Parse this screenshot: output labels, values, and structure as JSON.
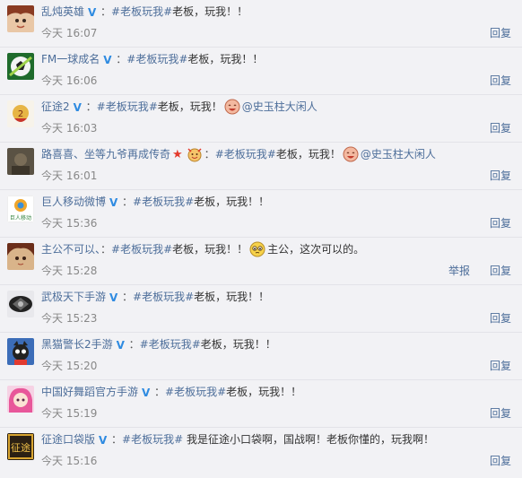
{
  "comments": [
    {
      "user": "乱炖英雄",
      "verified": true,
      "sep": "：",
      "tag": "#老板玩我#",
      "text": "老板，玩我！！",
      "time": "今天 16:07",
      "reply": "回复",
      "avatar_icon": "anime-character-avatar-icon"
    },
    {
      "user": "FM一球成名",
      "verified": true,
      "sep": "：",
      "tag": "#老板玩我#",
      "text": "老板，玩我！！",
      "time": "今天 16:06",
      "reply": "回复",
      "avatar_icon": "soccer-ball-avatar-icon"
    },
    {
      "user": "征途2",
      "verified": true,
      "sep": "：",
      "tag": "#老板玩我#",
      "text": "老板，玩我！",
      "emoji": "laughing-face-emoji",
      "mention": "@史玉柱大闲人",
      "time": "今天 16:03",
      "reply": "回复",
      "avatar_icon": "game-logo-avatar-icon"
    },
    {
      "user": "路喜喜、坐等九爷再成传奇",
      "star": "★",
      "emoji_pre": "cheering-face-emoji",
      "sep": "：",
      "tag": "#老板玩我#",
      "text": "老板，玩我！",
      "emoji": "laughing-face-emoji",
      "mention": "@史玉柱大闲人",
      "time": "今天 16:01",
      "reply": "回复",
      "avatar_icon": "dark-photo-avatar-icon"
    },
    {
      "user": "巨人移动微博",
      "verified": true,
      "sep": "：",
      "tag": "#老板玩我#",
      "text": "老板，玩我！！",
      "time": "今天 15:36",
      "reply": "回复",
      "avatar_icon": "giant-logo-avatar-icon",
      "avatar_text": "巨人移动"
    },
    {
      "user": "主公不可以、",
      "sep": "：",
      "tag": "#老板玩我#",
      "text": "老板，玩我！！",
      "emoji": "pleading-face-emoji",
      "text2": "主公，这次可以的。",
      "time": "今天 15:28",
      "report": "举报",
      "reply": "回复",
      "avatar_icon": "anime-girl-avatar-icon"
    },
    {
      "user": "武极天下手游",
      "verified": true,
      "sep": "：",
      "tag": "#老板玩我#",
      "text": "老板，玩我！！",
      "time": "今天 15:23",
      "reply": "回复",
      "avatar_icon": "dark-emblem-avatar-icon"
    },
    {
      "user": "黑猫警长2手游",
      "verified": true,
      "sep": "：",
      "tag": "#老板玩我#",
      "text": "老板，玩我！！",
      "time": "今天 15:20",
      "reply": "回复",
      "avatar_icon": "cartoon-cat-avatar-icon"
    },
    {
      "user": "中国好舞蹈官方手游",
      "verified": true,
      "sep": "：",
      "tag": "#老板玩我#",
      "text": "老板，玩我！！",
      "time": "今天 15:19",
      "reply": "回复",
      "avatar_icon": "pink-hair-girl-avatar-icon"
    },
    {
      "user": "征途口袋版",
      "verified": true,
      "sep": "：",
      "tag": "#老板玩我#",
      "text": " 我是征途小口袋啊，国战啊！老板你懂的，玩我啊！",
      "time": "今天 15:16",
      "reply": "回复",
      "avatar_icon": "gold-character-avatar-icon",
      "avatar_text": "征途"
    }
  ],
  "colors": {
    "link": "#4d6e9a",
    "verified": "#2f8be1",
    "time": "#888888",
    "text": "#333333",
    "background": "#f2f2f5"
  }
}
